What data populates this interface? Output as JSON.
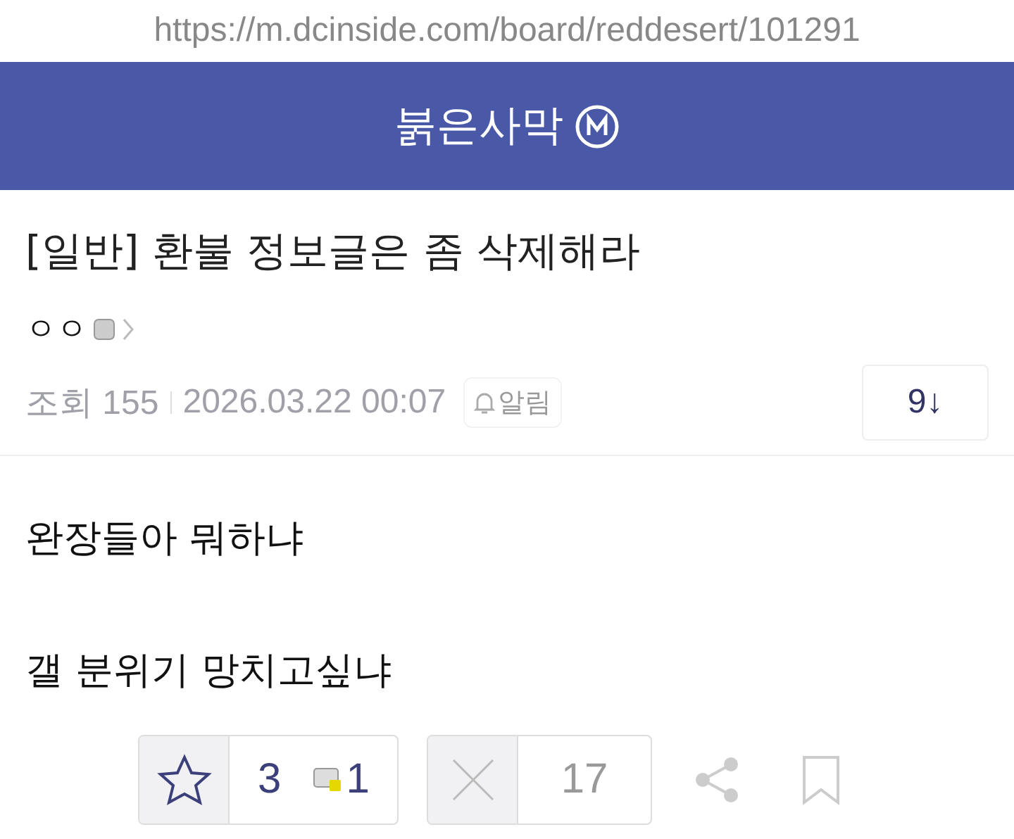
{
  "url": "https://m.dcinside.com/board/reddesert/101291",
  "header": {
    "title": "붉은사막"
  },
  "post": {
    "title": "[일반] 환불 정보글은 좀 삭제해라",
    "author": "ㅇㅇ",
    "views": "조회 155",
    "date": "2026.03.22 00:07",
    "alert": "알림",
    "comment_count": "9↓"
  },
  "body": [
    "완장들아 뭐하냐",
    "갤 분위기 망치고싶냐"
  ],
  "actions": {
    "upvotes": "3",
    "fixed_upvotes": "1",
    "downvotes": "17"
  }
}
